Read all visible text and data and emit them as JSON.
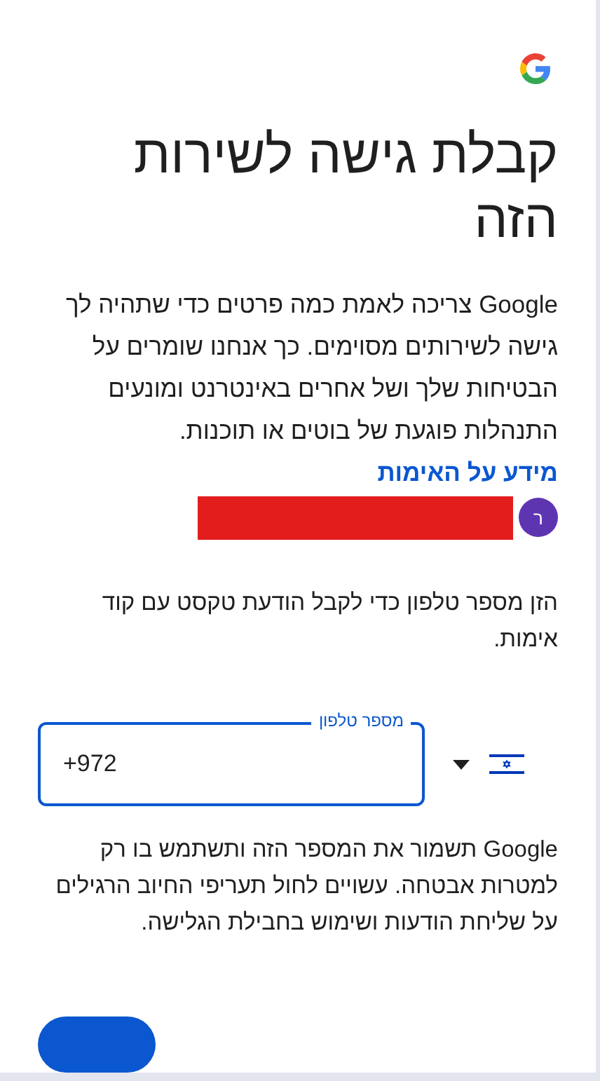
{
  "title": "קבלת גישה לשירות הזה",
  "intro": {
    "text": "Google צריכה לאמת כמה פרטים כדי שתהיה לך גישה לשירותים מסוימים. כך אנחנו שומרים על הבטיחות שלך ושל אחרים באינטרנט ומונעים התנהלות פוגעת של בוטים או תוכנות.",
    "link": "מידע על האימות"
  },
  "account": {
    "avatar_letter": "ר",
    "email_redacted": true
  },
  "instruction": "הזן מספר טלפון כדי לקבל הודעת טקסט עם קוד אימות.",
  "phone_field": {
    "label": "מספר טלפון",
    "value": "+972",
    "focused": true
  },
  "note": "Google תשמור את המספר הזה ותשתמש בו רק למטרות אבטחה. עשויים לחול תעריפי החיוב הרגילים על שליחת הודעות ושימוש בחבילת הגלישה."
}
